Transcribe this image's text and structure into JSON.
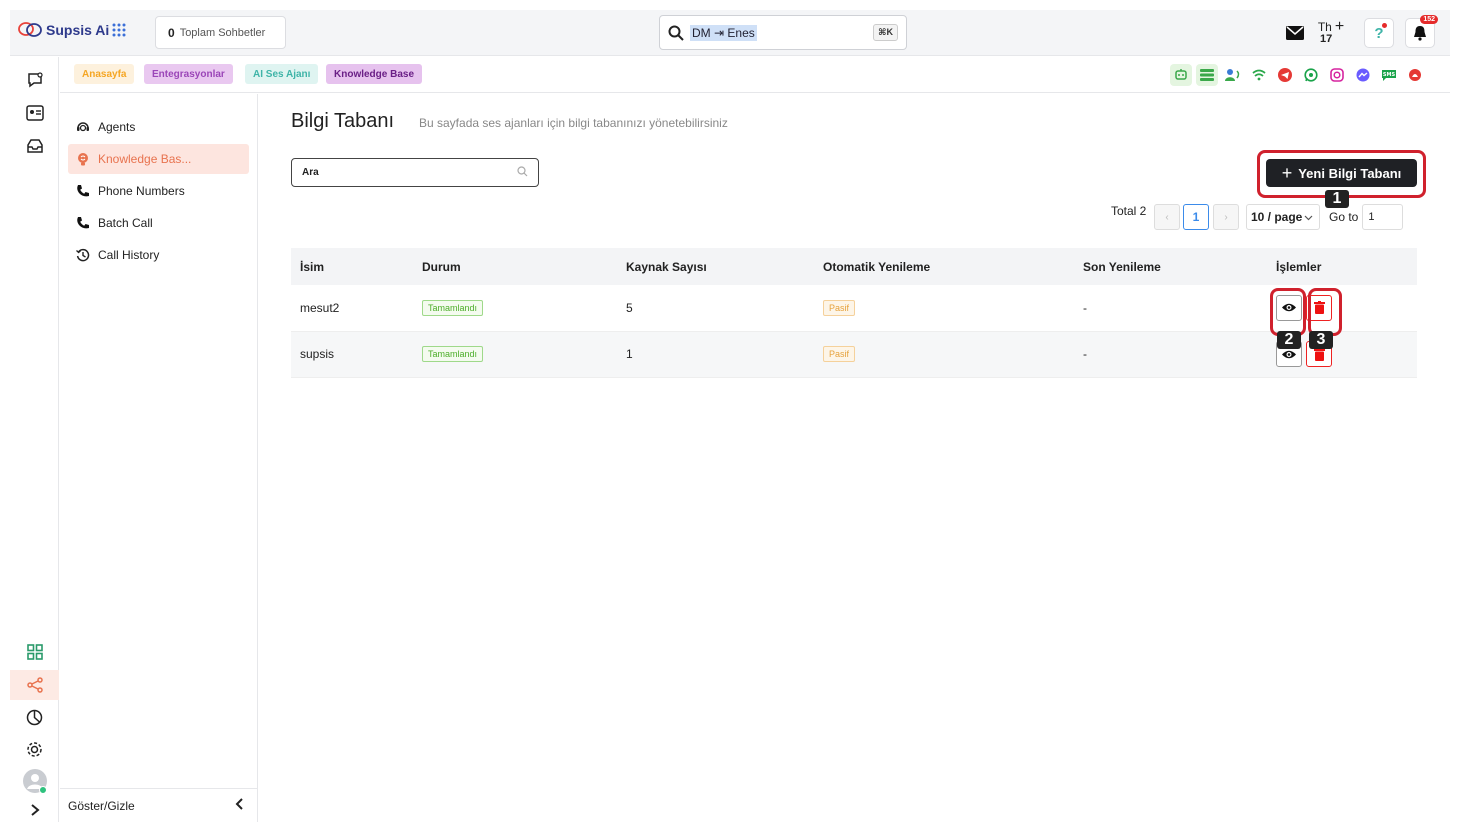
{
  "app": {
    "name": "Supsis Ai"
  },
  "topbar": {
    "chats_count": "0",
    "chats_label": "Toplam Sohbetler",
    "search_text": "DM ⇥ Enes",
    "search_shortcut": "⌘K",
    "th_label": "Th",
    "th_day": "17",
    "notification_count": "152"
  },
  "tabs": [
    {
      "label": "Anasayfa",
      "color": "#f5a623",
      "bg": "#fdf1dd"
    },
    {
      "label": "Entegrasyonlar",
      "color": "#9b46b8",
      "bg": "#e9c8f0"
    },
    {
      "label": "AI Ses Ajanı",
      "color": "#3fb4a8",
      "bg": "#dff4f1"
    },
    {
      "label": "Knowledge Base",
      "color": "#6a1f86",
      "bg": "#e6c2ee"
    }
  ],
  "channels": [
    "chatbot-icon",
    "list-icon",
    "voice-agent-icon",
    "wifi-icon",
    "telegram-icon",
    "whatsapp-icon",
    "instagram-icon",
    "messenger-icon",
    "sms-icon",
    "webchat-icon"
  ],
  "sidenav": {
    "items": [
      {
        "label": "Agents",
        "icon": "agent-icon"
      },
      {
        "label": "Knowledge Bas...",
        "icon": "brain-icon"
      },
      {
        "label": "Phone Numbers",
        "icon": "phone-icon"
      },
      {
        "label": "Batch Call",
        "icon": "phone-icon"
      },
      {
        "label": "Call History",
        "icon": "history-icon"
      }
    ],
    "toggle_label": "Göster/Gizle"
  },
  "page": {
    "title": "Bilgi Tabanı",
    "subtitle": "Bu sayfada ses ajanları için bilgi tabanınızı yönetebilirsiniz",
    "search_placeholder": "Ara",
    "new_button": "Yeni Bilgi Tabanı"
  },
  "pagination": {
    "total": "Total 2",
    "current_page": "1",
    "page_size": "10 / page",
    "goto_label": "Go to",
    "goto_value": "1"
  },
  "table": {
    "headers": [
      "İsim",
      "Durum",
      "Kaynak Sayısı",
      "Otomatik Yenileme",
      "Son Yenileme",
      "İşlemler"
    ],
    "rows": [
      {
        "name": "mesut2",
        "status": "Tamamlandı",
        "sources": "5",
        "auto_refresh": "Pasif",
        "last_refresh": "-"
      },
      {
        "name": "supsis",
        "status": "Tamamlandı",
        "sources": "1",
        "auto_refresh": "Pasif",
        "last_refresh": "-"
      }
    ]
  },
  "annotations": [
    "1",
    "2",
    "3"
  ],
  "colors": {
    "accent": "#e8734f",
    "highlight": "#d0212d",
    "primary_button": "#1f2125"
  }
}
